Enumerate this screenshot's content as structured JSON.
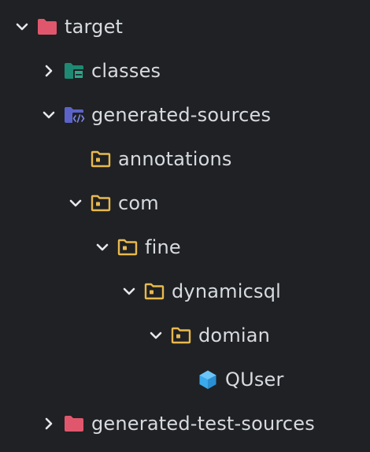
{
  "tree": {
    "items": [
      {
        "label": "target",
        "expanded": true,
        "icon": "folder-red-icon"
      },
      {
        "label": "classes",
        "expanded": false,
        "icon": "folder-teal-output-icon"
      },
      {
        "label": "generated-sources",
        "expanded": true,
        "icon": "folder-purple-source-icon"
      },
      {
        "label": "annotations",
        "expanded": null,
        "icon": "package-folder-icon"
      },
      {
        "label": "com",
        "expanded": true,
        "icon": "package-folder-icon"
      },
      {
        "label": "fine",
        "expanded": true,
        "icon": "package-folder-icon"
      },
      {
        "label": "dynamicsql",
        "expanded": true,
        "icon": "package-folder-icon"
      },
      {
        "label": "domian",
        "expanded": true,
        "icon": "package-folder-icon"
      },
      {
        "label": "QUser",
        "expanded": null,
        "icon": "class-cube-icon"
      },
      {
        "label": "generated-test-sources",
        "expanded": false,
        "icon": "folder-red-icon"
      }
    ]
  },
  "colors": {
    "background": "#1f2124",
    "text": "#d7dadf",
    "chevron": "#e6e8eb",
    "folder_red": "#e0576d",
    "folder_teal": "#1e8a73",
    "folder_purple": "#5b63c9",
    "package_yellow": "#e8b94f",
    "class_blue": "#3aa9ee"
  }
}
